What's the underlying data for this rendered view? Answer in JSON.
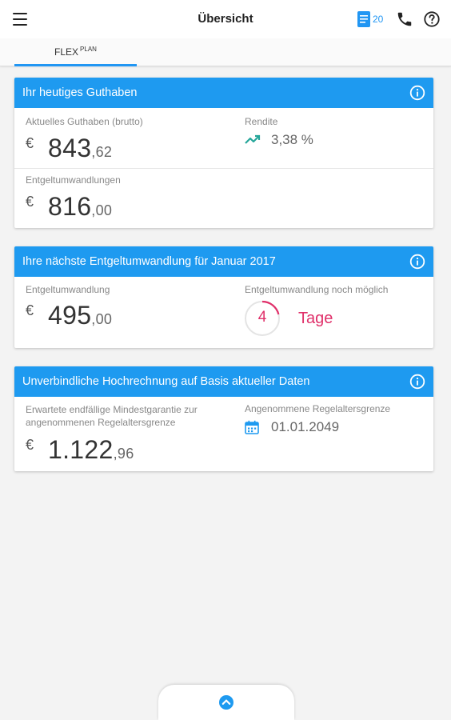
{
  "header": {
    "title": "Übersicht",
    "doc_count": "20"
  },
  "tabs": [
    {
      "label": "FLEX",
      "sup": "PLAN",
      "active": true
    }
  ],
  "card1": {
    "title": "Ihr heutiges Guthaben",
    "balance_label": "Aktuelles Guthaben (brutto)",
    "balance_currency": "€",
    "balance_int": "843",
    "balance_dec": ",62",
    "yield_label": "Rendite",
    "yield_value": "3,38 %",
    "conversions_label": "Entgeltumwandlungen",
    "conversions_currency": "€",
    "conversions_int": "816",
    "conversions_dec": ",00"
  },
  "card2": {
    "title": "Ihre nächste Entgeltumwandlung für Januar 2017",
    "conversion_label": "Entgeltumwandlung",
    "conversion_currency": "€",
    "conversion_int": "495",
    "conversion_dec": ",00",
    "possible_label": "Entgeltumwandlung noch möglich",
    "days_value": "4",
    "days_unit": "Tage"
  },
  "card3": {
    "title": "Unverbindliche Hochrechnung auf Basis aktueller Daten",
    "guarantee_label_line1": "Erwartete endfällige Mindestgarantie zur",
    "guarantee_label_line2": "angenommenen Regelaltersgrenze",
    "guarantee_currency": "€",
    "guarantee_int": "1.122",
    "guarantee_dec": ",96",
    "retirement_label": "Angenommene Regelaltersgrenze",
    "retirement_date": "01.01.2049"
  },
  "icons": {
    "menu": "hamburger-menu-icon",
    "documents": "document-icon",
    "phone": "phone-icon",
    "help": "help-circle-icon",
    "info": "info-circle-icon",
    "trend": "trending-up-icon",
    "calendar": "calendar-icon",
    "expand": "chevron-up-circle-icon"
  },
  "colors": {
    "accent_blue": "#1e9af0",
    "trend_green": "#26a69a",
    "days_pink": "#e0306a"
  }
}
